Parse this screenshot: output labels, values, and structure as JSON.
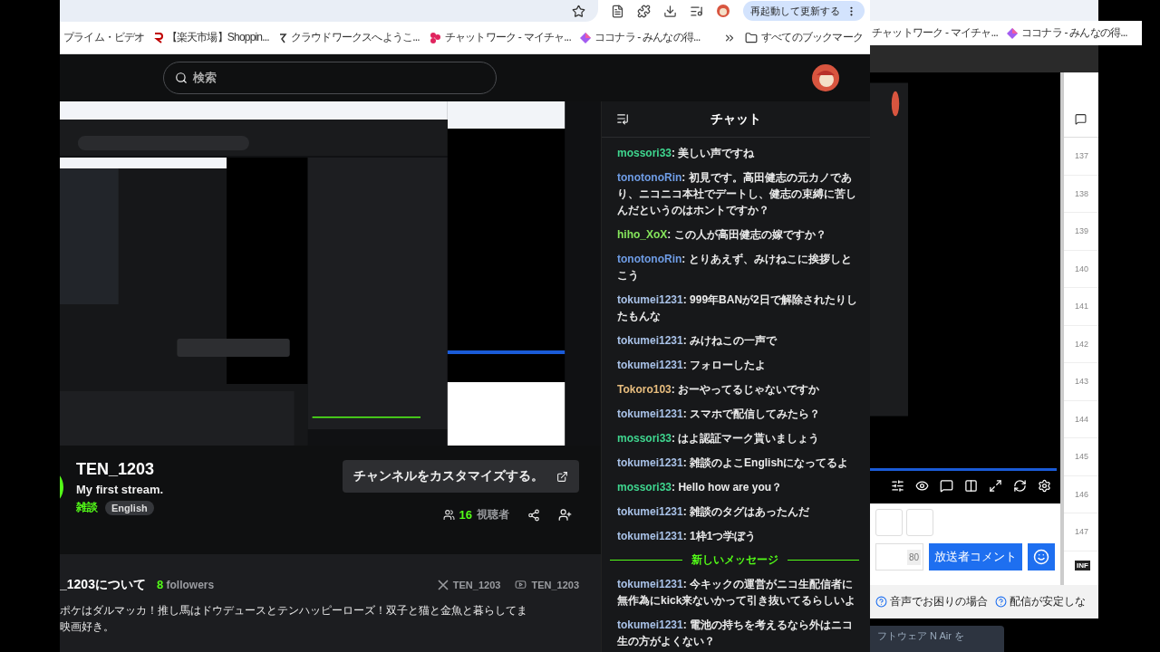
{
  "browser": {
    "restart_button": "再起動して更新する",
    "bookmarks": [
      {
        "kind": "plain",
        "label": "プライム・ビデオ"
      },
      {
        "kind": "rakuten",
        "label": "【楽天市場】Shoppin..."
      },
      {
        "kind": "crowdworks",
        "label": "クラウドワークスへようこ..."
      },
      {
        "kind": "chatwork",
        "label": "チャットワーク - マイチャ..."
      },
      {
        "kind": "coconala",
        "label": "ココナラ - みんなの得..."
      }
    ],
    "all_bookmarks": "すべてのブックマーク"
  },
  "header": {
    "search_placeholder": "検索"
  },
  "channel": {
    "name": "TEN_1203",
    "title": "My first stream.",
    "category": "雑談",
    "tags": [
      "English"
    ],
    "customize_button": "チャンネルをカスタマイズする。",
    "viewer_count": "16",
    "viewer_label": "視聴者"
  },
  "about": {
    "title": "_1203について",
    "followers_count": "8",
    "followers_label": "followers",
    "socials": [
      {
        "kind": "x",
        "handle": "TEN_1203"
      },
      {
        "kind": "youtube",
        "handle": "TEN_1203"
      }
    ],
    "bio": [
      "ポケはダルマッカ！推し馬はドウデュースとテンハッピーローズ！双子と猫と金魚と暮らしてま",
      "映画好き。"
    ]
  },
  "chat": {
    "title": "チャット",
    "separator": ":",
    "messages": [
      {
        "kind": "message",
        "user": "mossori33",
        "color": "#3fd68f",
        "text": "美しい声ですね"
      },
      {
        "kind": "message",
        "user": "tonotonoRin",
        "color": "#6f9de6",
        "text": "初見です。高田健志の元カノであり、ニコニコ本社でデートし、健志の束縛に苦しんだというのはホントですか？"
      },
      {
        "kind": "message",
        "user": "hiho_XoX",
        "color": "#86e65c",
        "text": "この人が高田健志の嫁ですか？"
      },
      {
        "kind": "message",
        "user": "tonotonoRin",
        "color": "#6f9de6",
        "text": "とりあえず、みけねこに挨拶しとこう"
      },
      {
        "kind": "message",
        "user": "tokumei1231",
        "color": "#a9c2e8",
        "text": "999年BANが2日で解除されたりしたもんな"
      },
      {
        "kind": "message",
        "user": "tokumei1231",
        "color": "#a9c2e8",
        "text": "みけねこの一声で"
      },
      {
        "kind": "message",
        "user": "tokumei1231",
        "color": "#a9c2e8",
        "text": "フォローしたよ"
      },
      {
        "kind": "message",
        "user": "Tokoro103",
        "color": "#e8bd7e",
        "text": "おーやってるじゃないですか"
      },
      {
        "kind": "message",
        "user": "tokumei1231",
        "color": "#a9c2e8",
        "text": "スマホで配信してみたら？"
      },
      {
        "kind": "message",
        "user": "mossori33",
        "color": "#3fd68f",
        "text": "はよ認証マーク貰いましょう"
      },
      {
        "kind": "message",
        "user": "tokumei1231",
        "color": "#a9c2e8",
        "text": "雑談のよこEnglishになってるよ"
      },
      {
        "kind": "message",
        "user": "mossori33",
        "color": "#3fd68f",
        "text": "Hello how are you？"
      },
      {
        "kind": "message",
        "user": "tokumei1231",
        "color": "#a9c2e8",
        "text": "雑談のタグはあったんだ"
      },
      {
        "kind": "message",
        "user": "tokumei1231",
        "color": "#a9c2e8",
        "text": "1枠1つ学ぼう"
      },
      {
        "kind": "divider",
        "text": "新しいメッセージ"
      },
      {
        "kind": "message",
        "user": "tokumei1231",
        "color": "#a9c2e8",
        "text": "今キックの運営がニコ生配信者に無作為にkick来ないかって引き抜いてるらしいよ"
      },
      {
        "kind": "message",
        "user": "tokumei1231",
        "color": "#a9c2e8",
        "text": "電池の持ちを考えるなら外はニコ生の方がよくない？"
      }
    ]
  },
  "back_window": {
    "bookmarks": [
      {
        "kind": "plain",
        "label": "チャットワーク - マイチャ..."
      },
      {
        "kind": "coconala",
        "label": "ココナラ - みんなの得..."
      }
    ],
    "progress": {
      "level": 1
    },
    "comment_count": "80",
    "comment_button": "放送者コメント",
    "help_links": [
      "音声でお困りの場合",
      "配信が安定しな"
    ],
    "banner": "フトウェア N Air を",
    "line_numbers": [
      "137",
      "138",
      "139",
      "140",
      "141",
      "142",
      "143",
      "144",
      "145",
      "146",
      "147"
    ],
    "badge": "INF"
  }
}
